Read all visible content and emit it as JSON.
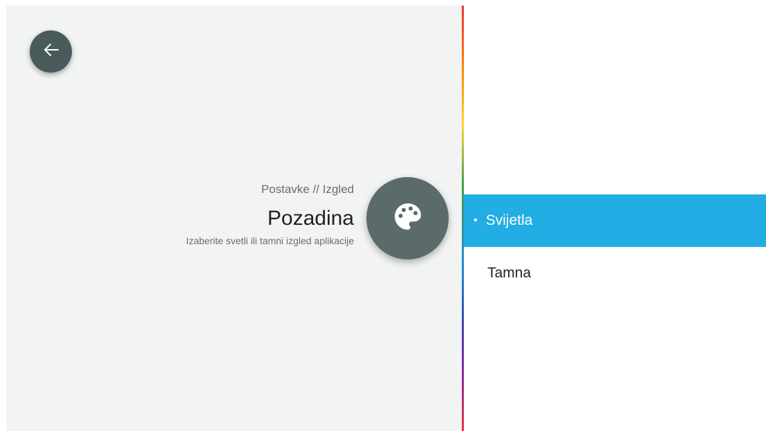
{
  "navigation": {
    "back_icon": "arrow-left-icon"
  },
  "header": {
    "breadcrumb": "Postavke // Izgled",
    "title": "Pozadina",
    "subtitle": "Izaberite svetli ili tamni izgled aplikacije",
    "badge_icon": "palette-icon"
  },
  "options": {
    "bullet": "•",
    "items": [
      {
        "label": "Svijetla",
        "selected": true
      },
      {
        "label": "Tamna",
        "selected": false
      }
    ]
  },
  "colors": {
    "accent": "#22ade5",
    "badge_background": "#5a6b6a",
    "back_button_background": "#485a59",
    "left_panel_background": "#f2f3f3"
  }
}
